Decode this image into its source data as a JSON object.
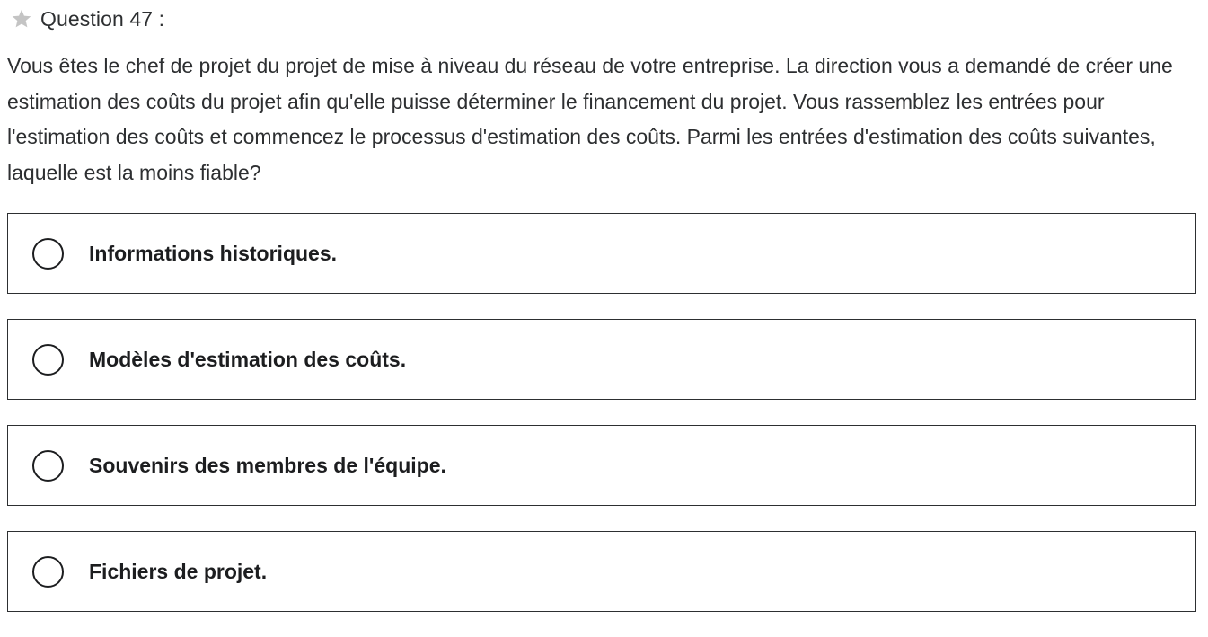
{
  "question": {
    "star_icon": "star-icon",
    "star_color": "#c4c4c4",
    "label": "Question 47 :",
    "text": "Vous êtes le chef de projet du projet de mise à niveau du réseau de votre entreprise. La direction vous a demandé de créer une estimation des coûts du projet afin qu'elle puisse déterminer le financement du projet. Vous rassemblez les entrées pour l'estimation des coûts et commencez le processus d'estimation des coûts. Parmi les entrées d'estimation des coûts suivantes, laquelle est la moins fiable?"
  },
  "options": [
    {
      "label": "Informations historiques.",
      "selected": false
    },
    {
      "label": "Modèles d'estimation des coûts.",
      "selected": false
    },
    {
      "label": "Souvenirs des membres de l'équipe.",
      "selected": false
    },
    {
      "label": "Fichiers de projet.",
      "selected": false
    }
  ]
}
